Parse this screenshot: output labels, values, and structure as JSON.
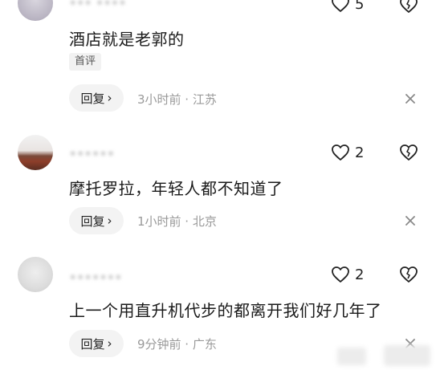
{
  "comments": [
    {
      "username": "••• ••••",
      "likes": "5",
      "text": "酒店就是老郭的",
      "tag": "首评",
      "reply_label": "回复",
      "meta": "3小时前 · 江苏"
    },
    {
      "username": "••••••",
      "likes": "2",
      "text": "摩托罗拉，年轻人都不知道了",
      "reply_label": "回复",
      "meta": "1小时前 · 北京"
    },
    {
      "username": "•••••••",
      "likes": "2",
      "text": "上一个用直升机代步的都离开我们好几年了",
      "reply_label": "回复",
      "meta": "9分钟前 · 广东"
    }
  ],
  "icons": {
    "like": "heart-outline-icon",
    "dislike": "broken-heart-icon",
    "close": "close-icon",
    "chevron": "chevron-right-icon"
  },
  "colors": {
    "text": "#1a1a1a",
    "meta": "#9a9a9a",
    "reply_bg": "#f3f3f3"
  }
}
